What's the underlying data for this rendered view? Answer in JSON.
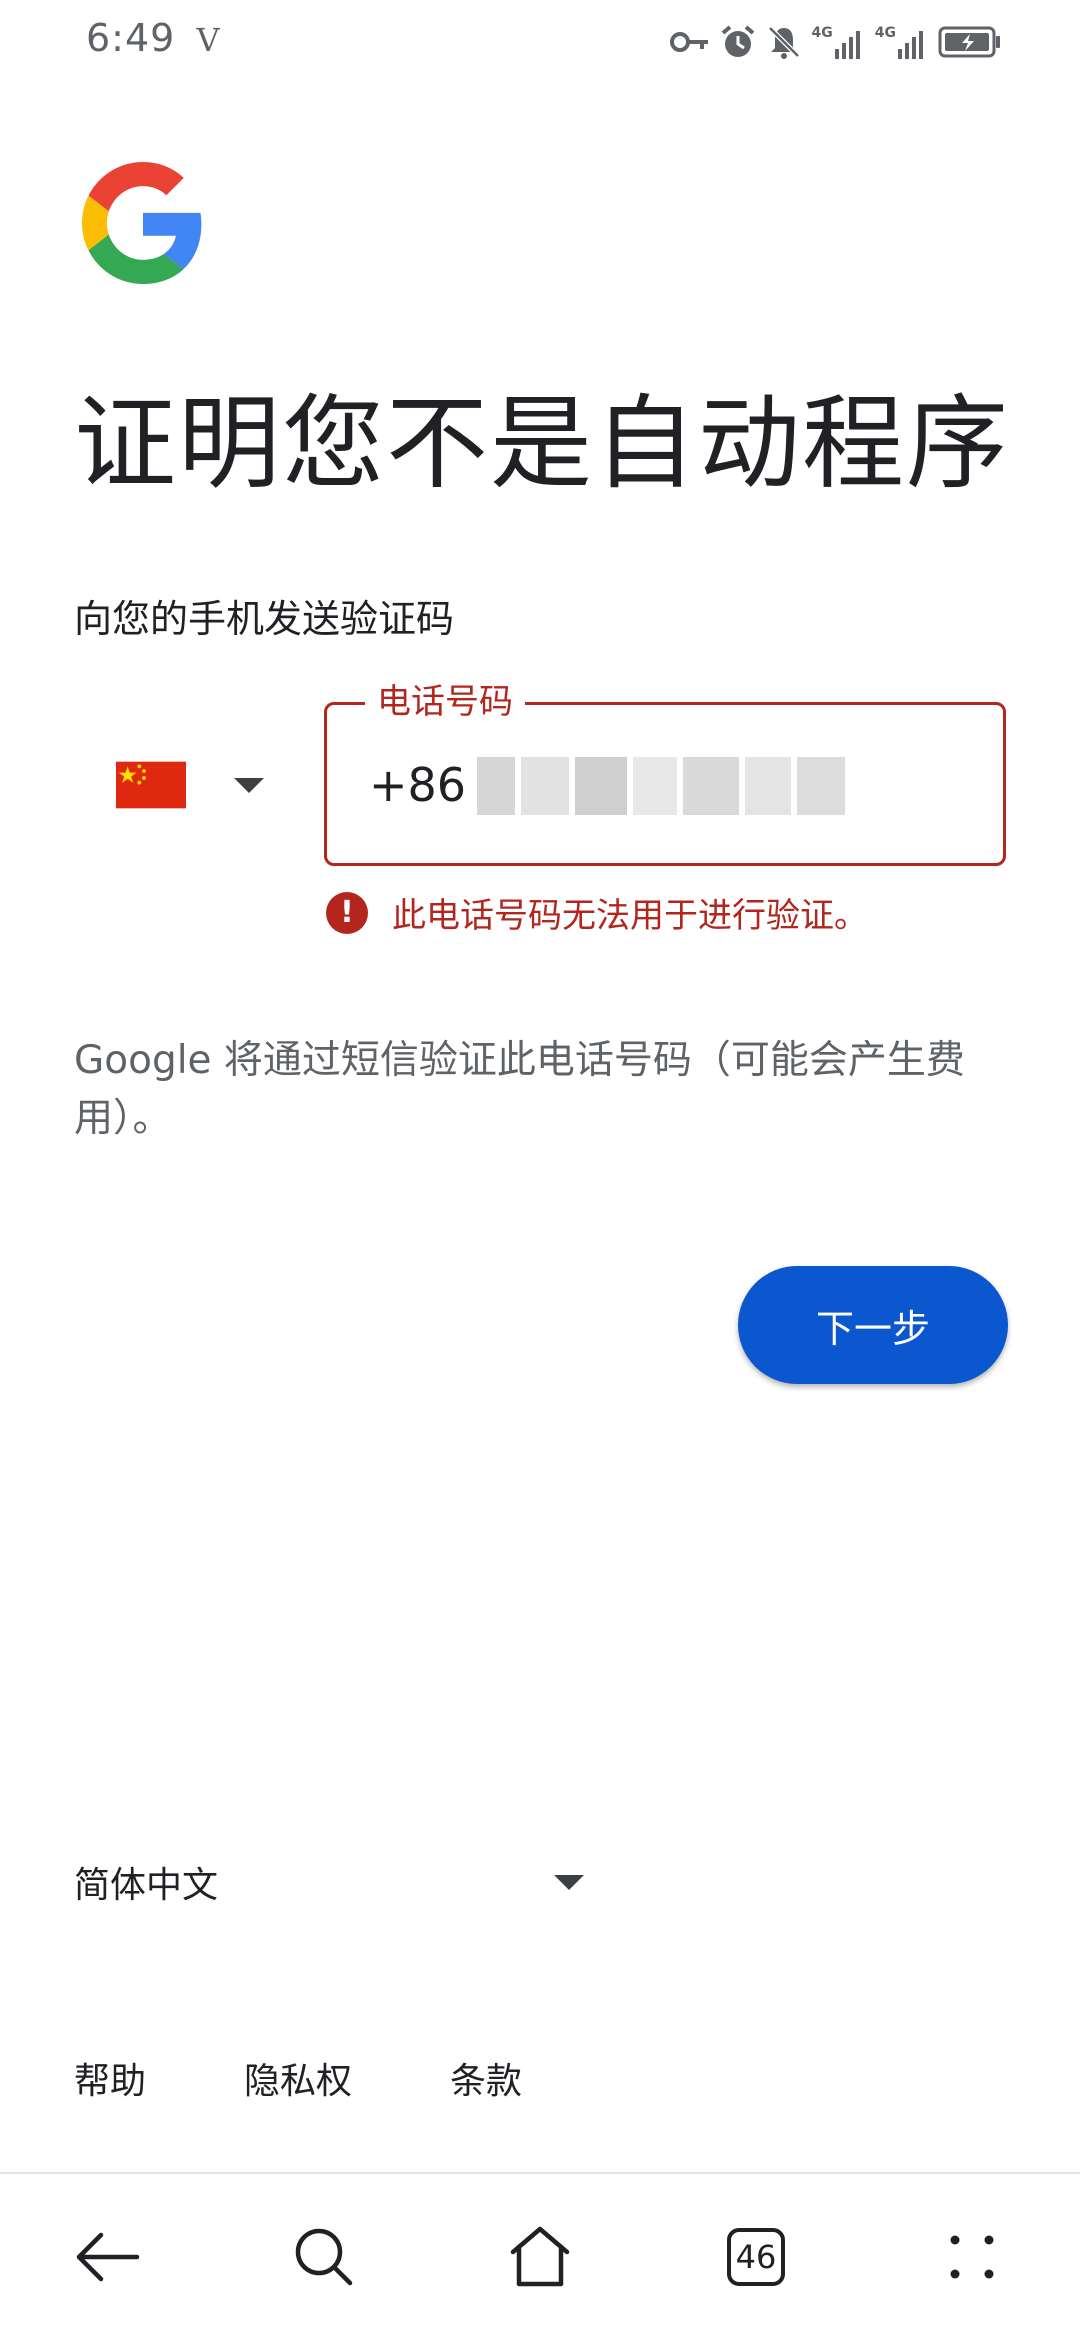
{
  "status_bar": {
    "time": "6:49",
    "carrier_mark": "V",
    "network_1": "4G",
    "network_2": "4G",
    "icons": [
      "key-icon",
      "alarm-icon",
      "bell-muted-icon",
      "signal-icon",
      "signal-icon",
      "battery-charging-icon"
    ]
  },
  "logo": {
    "icon": "google-g-logo"
  },
  "title": "证明您不是自动程序",
  "subtitle": "向您的手机发送验证码",
  "country": {
    "flag": "china-flag-icon",
    "caret": "caret-down-icon"
  },
  "phone": {
    "label": "电话号码",
    "value": "+86"
  },
  "error": {
    "icon_glyph": "!",
    "message": "此电话号码无法用于进行验证。"
  },
  "info": "Google 将通过短信验证此电话号码（可能会产生费用）。",
  "next_button": {
    "label": "下一步"
  },
  "language": {
    "selected": "简体中文"
  },
  "footer": {
    "help": "帮助",
    "privacy": "隐私权",
    "terms": "条款"
  },
  "bottom_nav": {
    "tab_count": "46"
  },
  "colors": {
    "error": "#b3261e",
    "primary": "#0b57d0",
    "text": "#202124",
    "secondary_text": "#5f6368"
  }
}
